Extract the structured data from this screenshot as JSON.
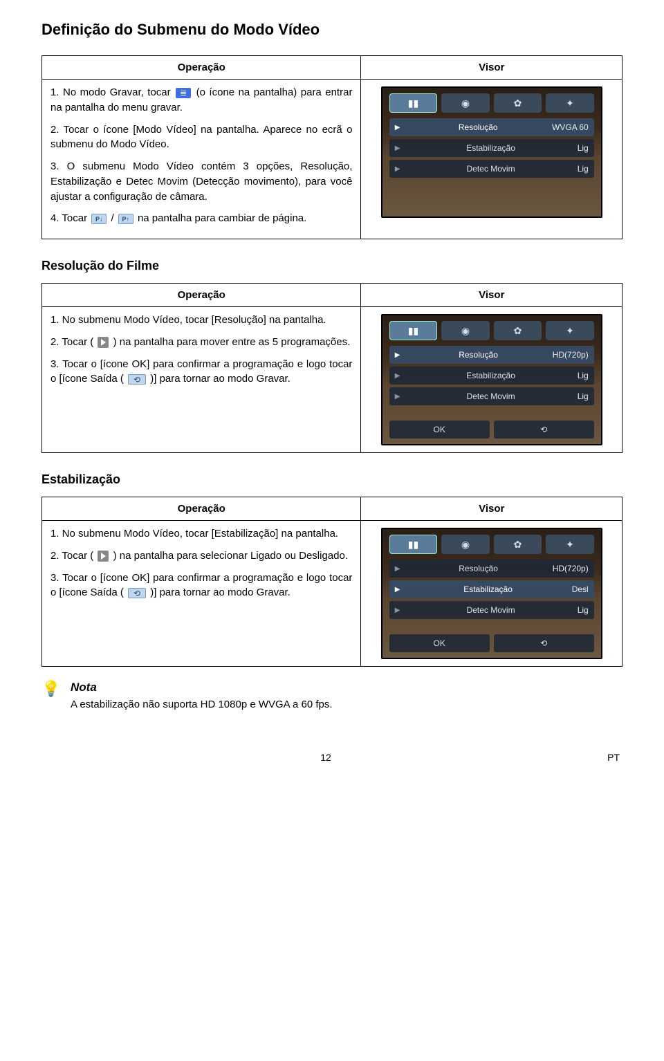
{
  "page_title": "Definição do Submenu do Modo Vídeo",
  "col_headers": {
    "op": "Operação",
    "visor": "Visor"
  },
  "section1": {
    "steps": {
      "s1a": "1.  No modo Gravar, tocar ",
      "s1b": " (o ícone na pantalha) para entrar na pantalha do menu gravar.",
      "s2": "2.  Tocar o ícone [Modo Vídeo] na pantalha. Aparece no ecrã o submenu do Modo Vídeo.",
      "s3": "3.  O submenu Modo Vídeo contém 3 opções, Resolução, Estabilização e Detec Movim (Detecção movimento), para você ajustar a configuração de câmara.",
      "s4a": "4.  Tocar ",
      "s4b": "/ ",
      "s4c": " na pantalha para cambiar de página."
    },
    "cam": {
      "rows": [
        {
          "label": "Resolução",
          "value": "WVGA 60",
          "sel": true
        },
        {
          "label": "Estabilização",
          "value": "Lig",
          "sel": false
        },
        {
          "label": "Detec Movim",
          "value": "Lig",
          "sel": false
        }
      ]
    }
  },
  "section2": {
    "title": "Resolução do Filme",
    "steps": {
      "s1": "1.  No submenu Modo Vídeo, tocar [Resolução] na pantalha.",
      "s2a": "2.  Tocar ( ",
      "s2b": " ) na pantalha para mover entre as 5 programações.",
      "s3a": "3.  Tocar o [ícone OK] para confirmar a programação e logo tocar o [ícone Saída ( ",
      "s3b": " )] para tornar ao modo Gravar."
    },
    "cam": {
      "rows": [
        {
          "label": "Resolução",
          "value": "HD(720p)",
          "sel": true
        },
        {
          "label": "Estabilização",
          "value": "Lig",
          "sel": false
        },
        {
          "label": "Detec Movim",
          "value": "Lig",
          "sel": false
        }
      ],
      "ok": "OK"
    }
  },
  "section3": {
    "title": "Estabilização",
    "steps": {
      "s1": "1.  No submenu Modo Vídeo, tocar [Estabilização] na pantalha.",
      "s2a": "2.  Tocar ( ",
      "s2b": " ) na pantalha para selecionar Ligado ou Desligado.",
      "s3a": "3.  Tocar o [ícone OK] para confirmar a programação e logo tocar o [ícone Saída ( ",
      "s3b": " )] para tornar ao modo Gravar."
    },
    "cam": {
      "rows": [
        {
          "label": "Resolução",
          "value": "HD(720p)",
          "sel": false
        },
        {
          "label": "Estabilização",
          "value": "Desl",
          "sel": true
        },
        {
          "label": "Detec Movim",
          "value": "Lig",
          "sel": false
        }
      ],
      "ok": "OK"
    }
  },
  "note": {
    "title": "Nota",
    "text": "A estabilização não suporta HD 1080p e WVGA a 60 fps."
  },
  "footer": {
    "page": "12",
    "lang": "PT"
  }
}
